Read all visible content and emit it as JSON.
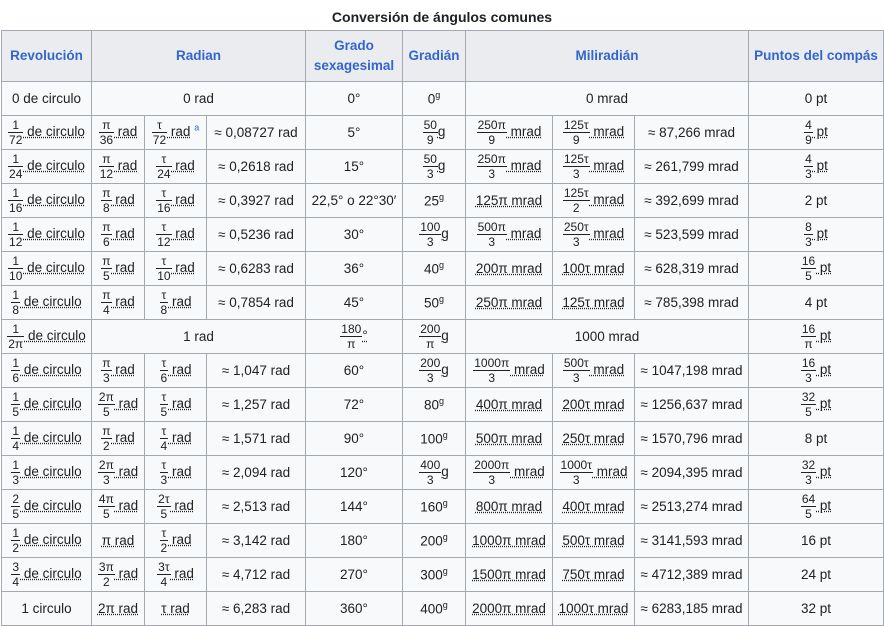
{
  "caption": "Conversión de ángulos comunes",
  "headers": [
    "Revolución",
    "Radian",
    "Grado sexagesimal",
    "Gradián",
    "Miliradián",
    "Puntos del compás"
  ],
  "note_marker": "a",
  "rows": [
    {
      "rev": {
        "t": "0 de circulo"
      },
      "rad_span": "0 rad",
      "deg": "0°",
      "grad": {
        "t": "0",
        "sup": "g"
      },
      "mrad_span": "0 mrad",
      "pts": {
        "t": "0 pt"
      }
    },
    {
      "rev": {
        "n": "1",
        "d": "72",
        "s": " de circulo"
      },
      "rad_pi": {
        "n": "π",
        "d": "36",
        "s": " rad"
      },
      "rad_tau": {
        "n": "τ",
        "d": "72",
        "s": " rad"
      },
      "rad_note": true,
      "rad_approx": "≈ 0,08727 rad",
      "deg": "5°",
      "grad": {
        "n": "50",
        "d": "9",
        "s": "g"
      },
      "mrad_pi": {
        "n": "250π",
        "d": "9",
        "s": " mrad"
      },
      "mrad_tau": {
        "n": "125τ",
        "d": "9",
        "s": " mrad"
      },
      "mrad_approx": "≈ 87,266 mrad",
      "pts": {
        "n": "4",
        "d": "9",
        "s": " pt"
      }
    },
    {
      "rev": {
        "n": "1",
        "d": "24",
        "s": " de circulo"
      },
      "rad_pi": {
        "n": "π",
        "d": "12",
        "s": " rad"
      },
      "rad_tau": {
        "n": "τ",
        "d": "24",
        "s": " rad"
      },
      "rad_approx": "≈ 0,2618 rad",
      "deg": "15°",
      "grad": {
        "n": "50",
        "d": "3",
        "s": "g"
      },
      "mrad_pi": {
        "n": "250π",
        "d": "3",
        "s": " mrad"
      },
      "mrad_tau": {
        "n": "125τ",
        "d": "3",
        "s": " mrad"
      },
      "mrad_approx": "≈ 261,799 mrad",
      "pts": {
        "n": "4",
        "d": "3",
        "s": " pt"
      }
    },
    {
      "rev": {
        "n": "1",
        "d": "16",
        "s": " de circulo"
      },
      "rad_pi": {
        "n": "π",
        "d": "8",
        "s": " rad"
      },
      "rad_tau": {
        "n": "τ",
        "d": "16",
        "s": " rad"
      },
      "rad_approx": "≈ 0,3927 rad",
      "deg": "22,5° o 22°30′",
      "grad": {
        "t": "25",
        "sup": "g"
      },
      "mrad_pi": {
        "t": "125π mrad"
      },
      "mrad_tau": {
        "n": "125τ",
        "d": "2",
        "s": " mrad"
      },
      "mrad_approx": "≈ 392,699 mrad",
      "pts": {
        "t": "2 pt"
      }
    },
    {
      "rev": {
        "n": "1",
        "d": "12",
        "s": " de circulo"
      },
      "rad_pi": {
        "n": "π",
        "d": "6",
        "s": " rad"
      },
      "rad_tau": {
        "n": "τ",
        "d": "12",
        "s": " rad"
      },
      "rad_approx": "≈ 0,5236 rad",
      "deg": "30°",
      "grad": {
        "n": "100",
        "d": "3",
        "s": "g"
      },
      "mrad_pi": {
        "n": "500π",
        "d": "3",
        "s": " mrad"
      },
      "mrad_tau": {
        "n": "250τ",
        "d": "3",
        "s": " mrad"
      },
      "mrad_approx": "≈ 523,599 mrad",
      "pts": {
        "n": "8",
        "d": "3",
        "s": " pt"
      }
    },
    {
      "rev": {
        "n": "1",
        "d": "10",
        "s": " de circulo"
      },
      "rad_pi": {
        "n": "π",
        "d": "5",
        "s": " rad"
      },
      "rad_tau": {
        "n": "τ",
        "d": "10",
        "s": " rad"
      },
      "rad_approx": "≈ 0,6283 rad",
      "deg": "36°",
      "grad": {
        "t": "40",
        "sup": "g"
      },
      "mrad_pi": {
        "t": "200π mrad"
      },
      "mrad_tau": {
        "t": "100τ mrad"
      },
      "mrad_approx": "≈ 628,319 mrad",
      "pts": {
        "n": "16",
        "d": "5",
        "s": " pt"
      }
    },
    {
      "rev": {
        "n": "1",
        "d": "8",
        "s": " de circulo"
      },
      "rad_pi": {
        "n": "π",
        "d": "4",
        "s": " rad"
      },
      "rad_tau": {
        "n": "τ",
        "d": "8",
        "s": " rad"
      },
      "rad_approx": "≈ 0,7854 rad",
      "deg": "45°",
      "grad": {
        "t": "50",
        "sup": "g"
      },
      "mrad_pi": {
        "t": "250π mrad"
      },
      "mrad_tau": {
        "t": "125τ mrad"
      },
      "mrad_approx": "≈ 785,398 mrad",
      "pts": {
        "t": "4 pt"
      }
    },
    {
      "rev": {
        "n": "1",
        "d": "2π",
        "s": " de circulo"
      },
      "rad_span": "1 rad",
      "deg_frac": {
        "n": "180",
        "d": "π",
        "s": "°"
      },
      "grad": {
        "n": "200",
        "d": "π",
        "s": "g"
      },
      "mrad_span": "1000 mrad",
      "pts": {
        "n": "16",
        "d": "π",
        "s": " pt"
      }
    },
    {
      "rev": {
        "n": "1",
        "d": "6",
        "s": " de circulo"
      },
      "rad_pi": {
        "n": "π",
        "d": "3",
        "s": " rad"
      },
      "rad_tau": {
        "n": "τ",
        "d": "6",
        "s": " rad"
      },
      "rad_approx": "≈ 1,047 rad",
      "deg": "60°",
      "grad": {
        "n": "200",
        "d": "3",
        "s": "g"
      },
      "mrad_pi": {
        "n": "1000π",
        "d": "3",
        "s": " mrad"
      },
      "mrad_tau": {
        "n": "500τ",
        "d": "3",
        "s": " mrad"
      },
      "mrad_approx": "≈ 1047,198 mrad",
      "pts": {
        "n": "16",
        "d": "3",
        "s": " pt"
      }
    },
    {
      "rev": {
        "n": "1",
        "d": "5",
        "s": " de circulo"
      },
      "rad_pi": {
        "n": "2π",
        "d": "5",
        "s": " rad"
      },
      "rad_tau": {
        "n": "τ",
        "d": "5",
        "s": " rad"
      },
      "rad_approx": "≈ 1,257 rad",
      "deg": "72°",
      "grad": {
        "t": "80",
        "sup": "g"
      },
      "mrad_pi": {
        "t": "400π mrad"
      },
      "mrad_tau": {
        "t": "200τ mrad"
      },
      "mrad_approx": "≈ 1256,637 mrad",
      "pts": {
        "n": "32",
        "d": "5",
        "s": " pt"
      }
    },
    {
      "rev": {
        "n": "1",
        "d": "4",
        "s": " de circulo"
      },
      "rad_pi": {
        "n": "π",
        "d": "2",
        "s": " rad"
      },
      "rad_tau": {
        "n": "τ",
        "d": "4",
        "s": " rad"
      },
      "rad_approx": "≈ 1,571 rad",
      "deg": "90°",
      "grad": {
        "t": "100",
        "sup": "g"
      },
      "mrad_pi": {
        "t": "500π mrad"
      },
      "mrad_tau": {
        "t": "250τ mrad"
      },
      "mrad_approx": "≈ 1570,796 mrad",
      "pts": {
        "t": "8 pt"
      }
    },
    {
      "rev": {
        "n": "1",
        "d": "3",
        "s": " de circulo"
      },
      "rad_pi": {
        "n": "2π",
        "d": "3",
        "s": " rad"
      },
      "rad_tau": {
        "n": "τ",
        "d": "3",
        "s": " rad"
      },
      "rad_approx": "≈ 2,094 rad",
      "deg": "120°",
      "grad": {
        "n": "400",
        "d": "3",
        "s": "g"
      },
      "mrad_pi": {
        "n": "2000π",
        "d": "3",
        "s": " mrad"
      },
      "mrad_tau": {
        "n": "1000τ",
        "d": "3",
        "s": " mrad"
      },
      "mrad_approx": "≈ 2094,395 mrad",
      "pts": {
        "n": "32",
        "d": "3",
        "s": " pt"
      }
    },
    {
      "rev": {
        "n": "2",
        "d": "5",
        "s": " de circulo"
      },
      "rad_pi": {
        "n": "4π",
        "d": "5",
        "s": " rad"
      },
      "rad_tau": {
        "n": "2τ",
        "d": "5",
        "s": " rad"
      },
      "rad_approx": "≈ 2,513 rad",
      "deg": "144°",
      "grad": {
        "t": "160",
        "sup": "g"
      },
      "mrad_pi": {
        "t": "800π mrad"
      },
      "mrad_tau": {
        "t": "400τ mrad"
      },
      "mrad_approx": "≈ 2513,274 mrad",
      "pts": {
        "n": "64",
        "d": "5",
        "s": " pt"
      }
    },
    {
      "rev": {
        "n": "1",
        "d": "2",
        "s": " de circulo"
      },
      "rad_pi": {
        "t": "π rad"
      },
      "rad_tau": {
        "n": "τ",
        "d": "2",
        "s": " rad"
      },
      "rad_approx": "≈ 3,142 rad",
      "deg": "180°",
      "grad": {
        "t": "200",
        "sup": "g"
      },
      "mrad_pi": {
        "t": "1000π mrad"
      },
      "mrad_tau": {
        "t": "500τ mrad"
      },
      "mrad_approx": "≈ 3141,593 mrad",
      "pts": {
        "t": "16 pt"
      }
    },
    {
      "rev": {
        "n": "3",
        "d": "4",
        "s": " de circulo"
      },
      "rad_pi": {
        "n": "3π",
        "d": "2",
        "s": " rad"
      },
      "rad_tau": {
        "n": "3τ",
        "d": "4",
        "s": " rad"
      },
      "rad_approx": "≈ 4,712 rad",
      "deg": "270°",
      "grad": {
        "t": "300",
        "sup": "g"
      },
      "mrad_pi": {
        "t": "1500π mrad"
      },
      "mrad_tau": {
        "t": "750τ mrad"
      },
      "mrad_approx": "≈ 4712,389 mrad",
      "pts": {
        "t": "24 pt"
      }
    },
    {
      "rev": {
        "t": "1 circulo"
      },
      "rad_pi": {
        "t": "2π rad"
      },
      "rad_tau": {
        "t": "τ rad"
      },
      "rad_approx": "≈ 6,283 rad",
      "deg": "360°",
      "grad": {
        "t": "400",
        "sup": "g"
      },
      "mrad_pi": {
        "t": "2000π mrad"
      },
      "mrad_tau": {
        "t": "1000τ mrad"
      },
      "mrad_approx": "≈ 6283,185 mrad",
      "pts": {
        "t": "32 pt"
      }
    }
  ]
}
